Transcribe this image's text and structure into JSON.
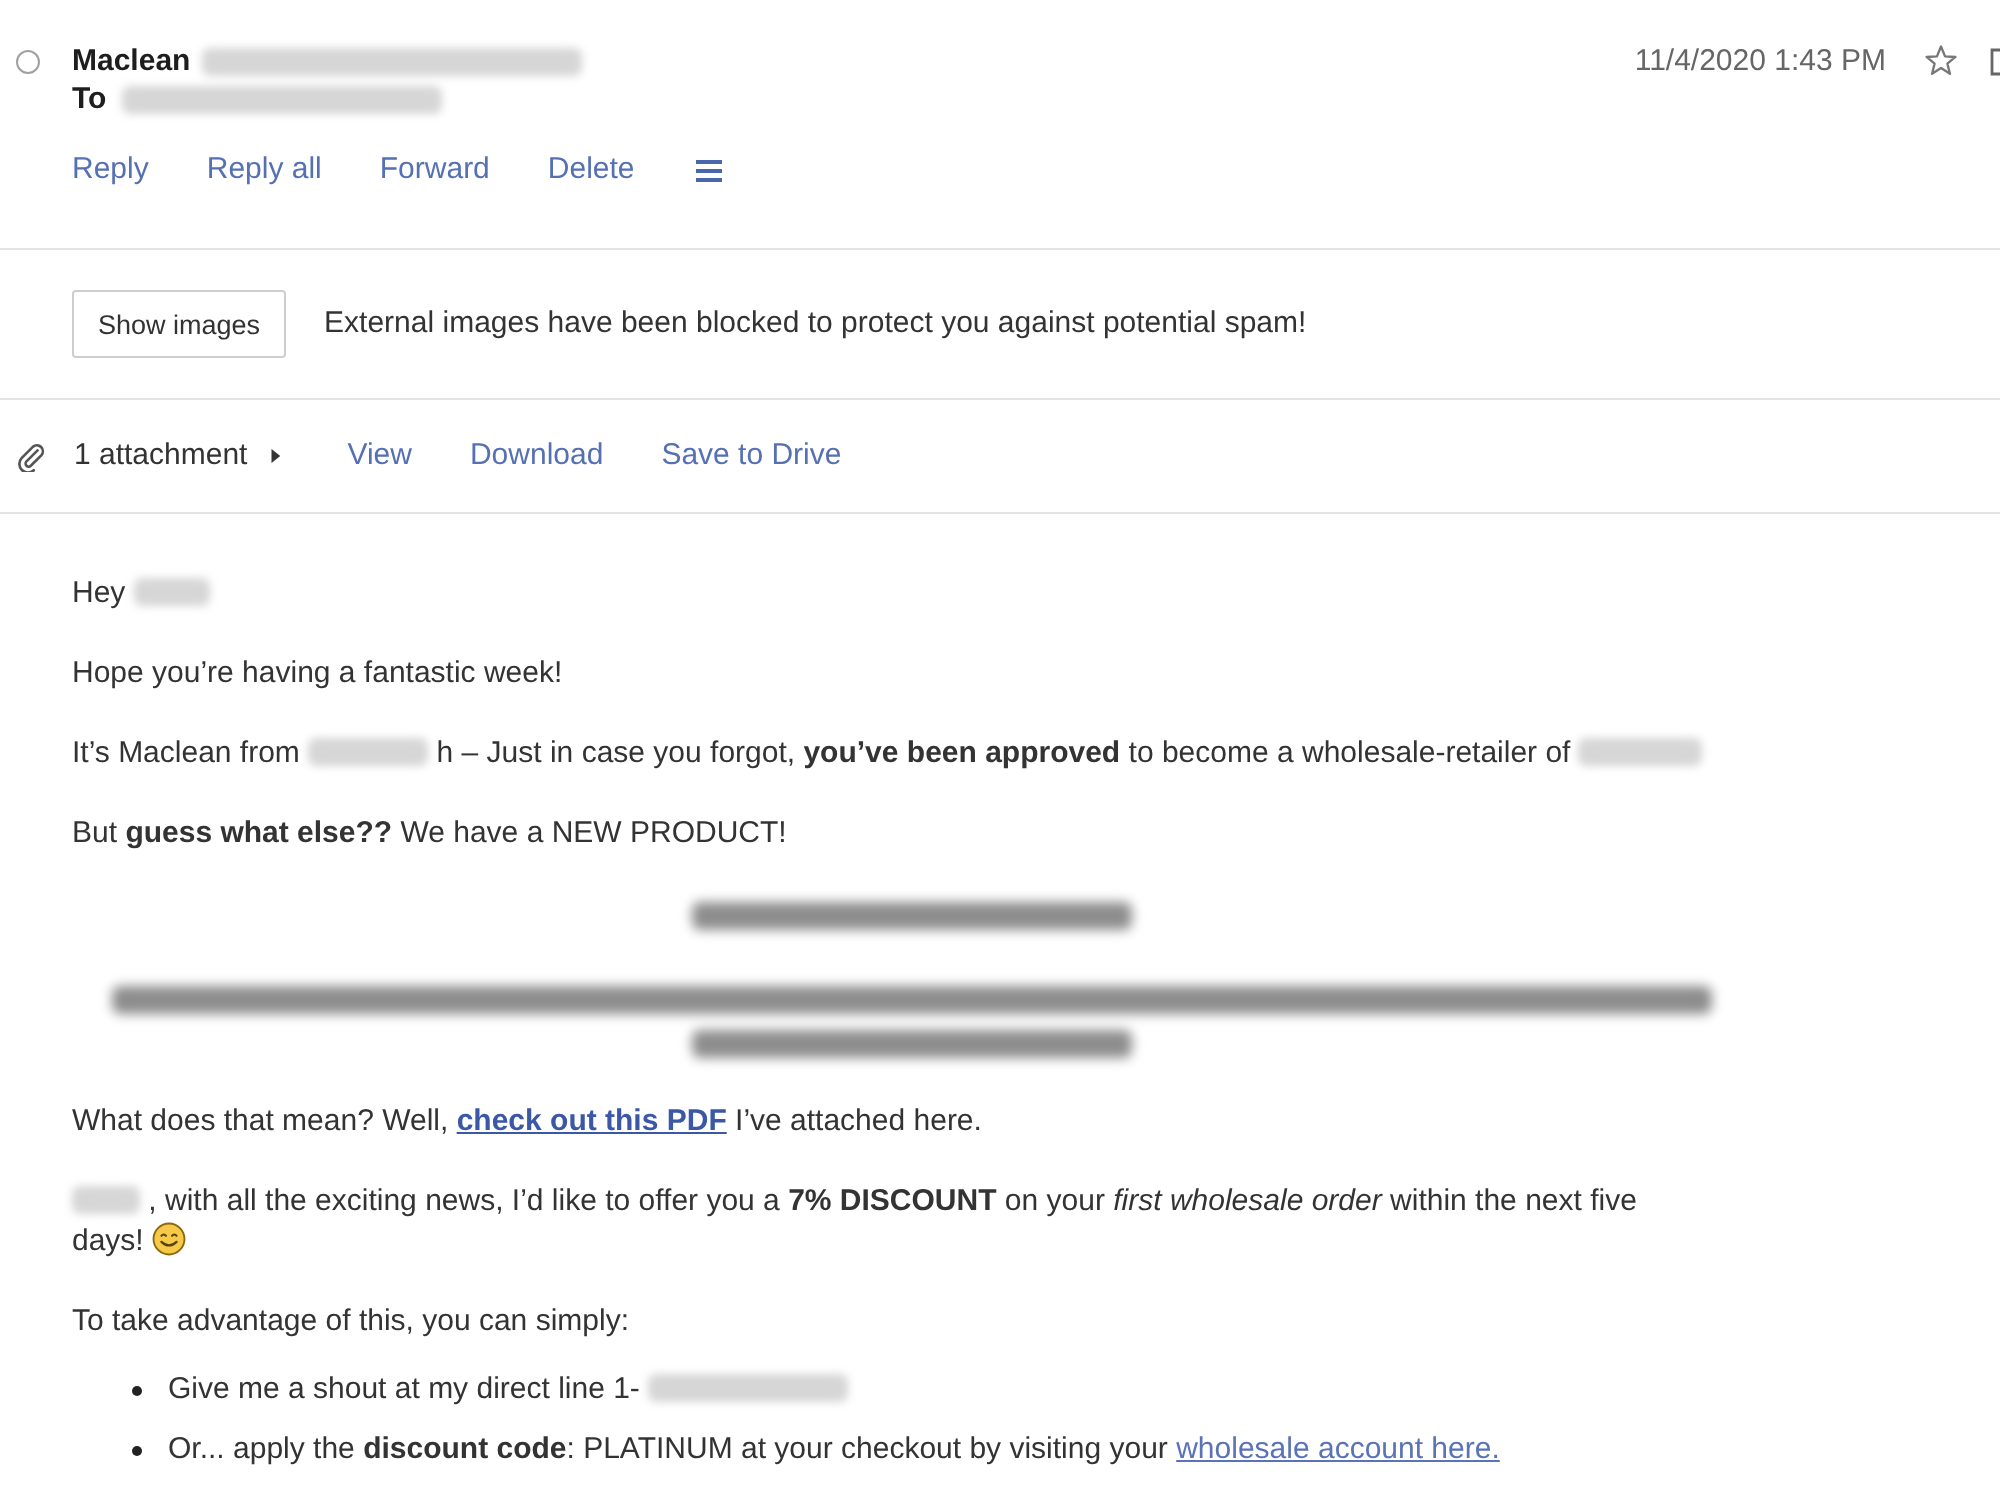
{
  "header": {
    "selected": false,
    "sender": "Maclean",
    "sender_hidden": true,
    "to_label": "To",
    "recipient_hidden": true,
    "date": "11/4/2020 1:43 PM",
    "starred": false
  },
  "actions": [
    "Reply",
    "Reply all",
    "Forward",
    "Delete"
  ],
  "notice": {
    "button": "Show images",
    "text": "External images have been blocked to protect you against potential spam!"
  },
  "attachments": {
    "label": "1 attachment",
    "expanded": false,
    "actions": [
      "View",
      "Download",
      "Save to Drive"
    ]
  },
  "body": [
    {
      "kind": "text",
      "lines": [
        [
          {
            "kind": "text",
            "text": "Hey"
          },
          {
            "kind": "redaction"
          }
        ]
      ]
    },
    {
      "kind": "text",
      "lines": [
        [
          {
            "kind": "text",
            "text": "Hope you’re having a fantastic week!"
          }
        ]
      ]
    },
    {
      "kind": "text",
      "lines": [
        [
          {
            "kind": "text",
            "text": "It’s Maclean from"
          },
          {
            "kind": "redaction"
          },
          {
            "kind": "text",
            "text": "h – Just in case you forgot, **you’ve been approved** to become a wholesale-retailer of"
          },
          {
            "kind": "redaction"
          }
        ]
      ]
    },
    {
      "kind": "text",
      "lines": [
        [
          {
            "kind": "text",
            "text": "But **guess what else??** We have a NEW PRODUCT!"
          }
        ]
      ]
    },
    {
      "kind": "blurred"
    },
    {
      "kind": "text",
      "lines": [
        [
          {
            "kind": "text",
            "text": "What does that mean? Well,"
          },
          {
            "kind": "link",
            "text": "check out this PDF",
            "bold": true
          },
          {
            "kind": "text",
            "text": "I’ve attached here."
          }
        ]
      ]
    },
    {
      "kind": "text",
      "lines": [
        [
          {
            "kind": "redaction"
          },
          {
            "kind": "text",
            "text": ", with all the exciting news, I’d like to offer you a **7% DISCOUNT** on your *first wholesale order* within the next five"
          }
        ],
        [
          {
            "kind": "text",
            "text": "days!"
          },
          {
            "kind": "emoji"
          }
        ]
      ]
    },
    {
      "kind": "text",
      "lines": [
        [
          {
            "kind": "text",
            "text": "To take advantage of this, you can simply:"
          }
        ]
      ]
    },
    {
      "kind": "bullet",
      "lines": [
        [
          {
            "kind": "text",
            "text": "Give me a shout at my direct line 1-"
          },
          {
            "kind": "redaction"
          }
        ]
      ]
    },
    {
      "kind": "bullet",
      "lines": [
        [
          {
            "kind": "text",
            "text": "Or... apply the **discount code**: PLATINUM at your checkout by visiting your"
          },
          {
            "kind": "link",
            "text": "wholesale account here.",
            "bold": false
          }
        ]
      ]
    }
  ]
}
